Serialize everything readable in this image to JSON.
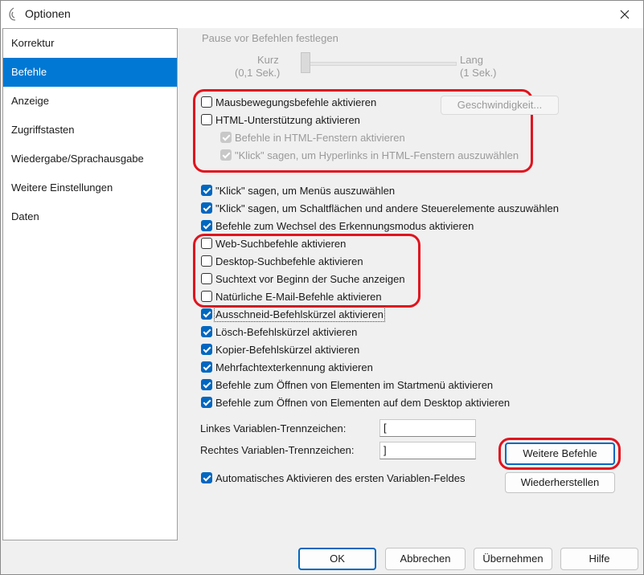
{
  "window": {
    "title": "Optionen",
    "close_icon": "close-icon",
    "app_icon": "speech-icon"
  },
  "sidebar": {
    "items": [
      {
        "label": "Korrektur"
      },
      {
        "label": "Befehle"
      },
      {
        "label": "Anzeige"
      },
      {
        "label": "Zugriffstasten"
      },
      {
        "label": "Wiedergabe/Sprachausgabe"
      },
      {
        "label": "Weitere Einstellungen"
      },
      {
        "label": "Daten"
      }
    ],
    "selected": "Befehle"
  },
  "pause": {
    "label": "Pause vor Befehlen festlegen",
    "short": "Kurz",
    "short_sub": "(0,1 Sek.)",
    "long": "Lang",
    "long_sub": "(1 Sek.)",
    "value": 0
  },
  "speed_button": "Geschwindigkeit...",
  "group1": [
    {
      "label": "Mausbewegungsbefehle aktivieren",
      "checked": false,
      "enabled": true
    },
    {
      "label": "HTML-Unterstützung aktivieren",
      "checked": false,
      "enabled": true
    },
    {
      "label": "Befehle in HTML-Fenstern aktivieren",
      "checked": true,
      "enabled": false
    },
    {
      "label": "\"Klick\" sagen, um Hyperlinks in HTML-Fenstern auszuwählen",
      "checked": true,
      "enabled": false
    }
  ],
  "group2": [
    {
      "label": "\"Klick\" sagen, um Menüs auszuwählen",
      "checked": true
    },
    {
      "label": "\"Klick\" sagen, um Schaltflächen und andere Steuerelemente auszuwählen",
      "checked": true
    },
    {
      "label": "Befehle zum Wechsel des Erkennungsmodus aktivieren",
      "checked": true
    }
  ],
  "group3": [
    {
      "label": "Web-Suchbefehle aktivieren",
      "checked": false
    },
    {
      "label": "Desktop-Suchbefehle aktivieren",
      "checked": false
    },
    {
      "label": "Suchtext vor Beginn der Suche anzeigen",
      "checked": false
    },
    {
      "label": "Natürliche E-Mail-Befehle aktivieren",
      "checked": false
    }
  ],
  "group4": [
    {
      "label": "Ausschneid-Befehlskürzel aktivieren",
      "checked": true
    },
    {
      "label": "Lösch-Befehlskürzel aktivieren",
      "checked": true
    },
    {
      "label": "Kopier-Befehlskürzel aktivieren",
      "checked": true
    },
    {
      "label": "Mehrfachtexterkennung aktivieren",
      "checked": true
    },
    {
      "label": "Befehle zum Öffnen von Elementen im Startmenü aktivieren",
      "checked": true
    },
    {
      "label": "Befehle zum Öffnen von Elementen auf dem Desktop aktivieren",
      "checked": true
    }
  ],
  "variables": {
    "left_label": "Linkes Variablen-Trennzeichen:",
    "left_value": "[",
    "right_label": "Rechtes Variablen-Trennzeichen:",
    "right_value": "]",
    "auto_label": "Automatisches Aktivieren des ersten Variablen-Feldes",
    "auto_checked": true
  },
  "more_button": "Weitere Befehle",
  "restore_button": "Wiederherstellen",
  "footer": {
    "ok": "OK",
    "cancel": "Abbrechen",
    "apply": "Übernehmen",
    "help": "Hilfe"
  },
  "colors": {
    "accent": "#0067c0",
    "highlight": "#e0141e",
    "selection": "#0078d4"
  }
}
